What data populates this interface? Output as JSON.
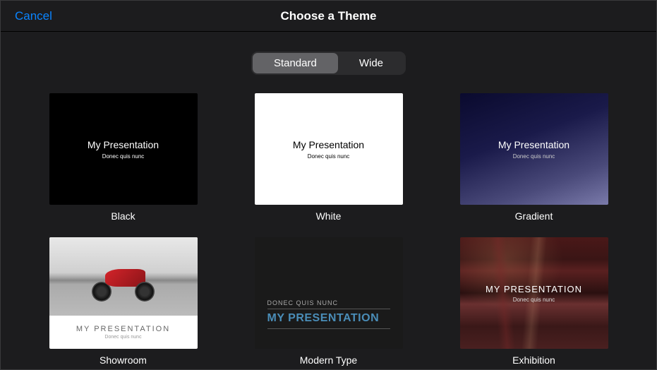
{
  "header": {
    "cancel": "Cancel",
    "title": "Choose a Theme"
  },
  "segments": {
    "standard": "Standard",
    "wide": "Wide",
    "active": "standard"
  },
  "sample": {
    "title": "My Presentation",
    "title_upper": "MY PRESENTATION",
    "subtitle": "Donec quis nunc",
    "subtitle_upper": "DONEC QUIS NUNC"
  },
  "themes": [
    {
      "id": "black",
      "label": "Black"
    },
    {
      "id": "white",
      "label": "White"
    },
    {
      "id": "gradient",
      "label": "Gradient"
    },
    {
      "id": "showroom",
      "label": "Showroom"
    },
    {
      "id": "modern",
      "label": "Modern Type"
    },
    {
      "id": "exhibition",
      "label": "Exhibition"
    }
  ]
}
